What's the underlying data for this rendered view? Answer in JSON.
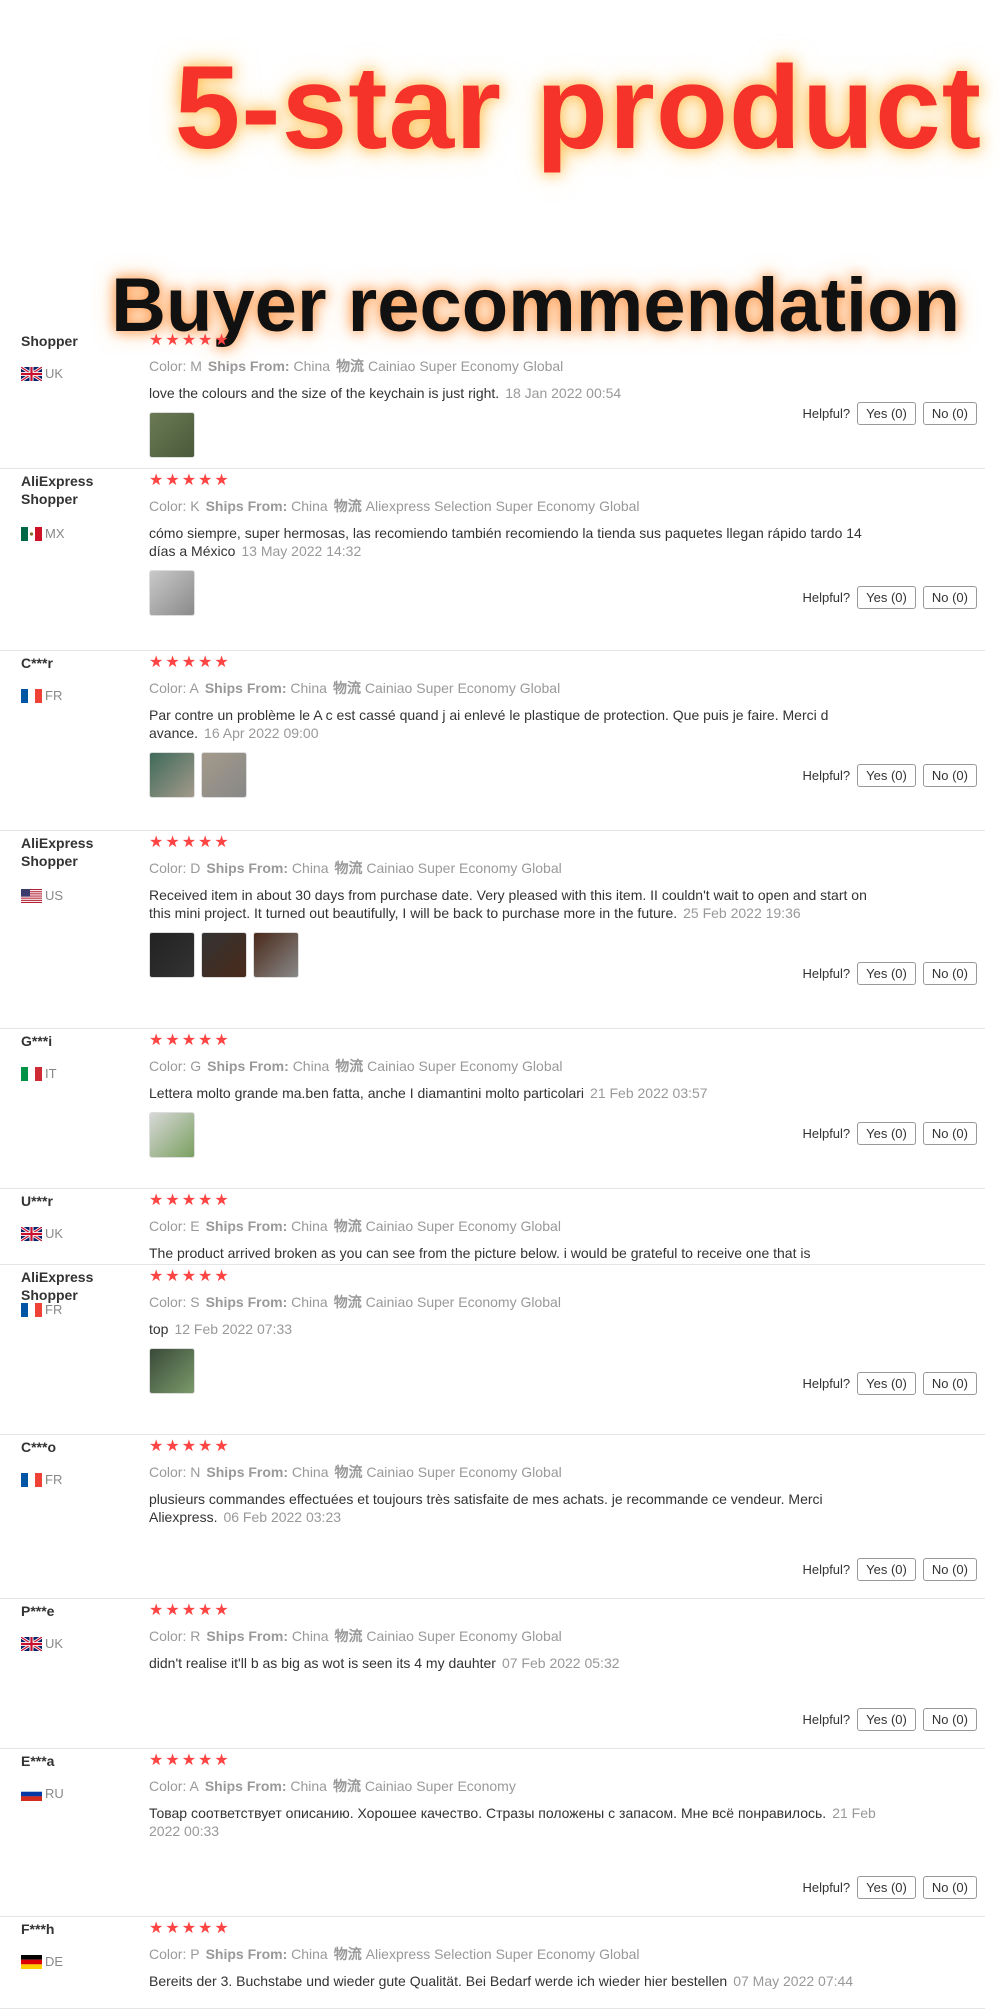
{
  "banner": {
    "title": "5-star product",
    "subtitle": "Buyer recommendation"
  },
  "labels": {
    "helpful": "Helpful?",
    "ships_from": "Ships From:",
    "logistics": "物流"
  },
  "reviews": [
    {
      "user": "Shopper",
      "country": "UK",
      "rating": 5,
      "color": "Color: M",
      "ship_from": "China",
      "logistics": "Cainiao Super Economy Global",
      "text": "love the colours and the size of the keychain is just right.",
      "date": "18 Jan 2022 00:54",
      "yes": "Yes (0)",
      "no": "No (0)"
    },
    {
      "user": "AliExpress Shopper",
      "country": "MX",
      "rating": 5,
      "color": "Color: K",
      "ship_from": "China",
      "logistics": "Aliexpress Selection Super Economy Global",
      "text": "cómo siempre, super hermosas, las recomiendo también recomiendo la tienda sus paquetes llegan rápido tardo 14 días a México",
      "date": "13 May 2022 14:32",
      "yes": "Yes (0)",
      "no": "No (0)"
    },
    {
      "user": "C***r",
      "country": "FR",
      "rating": 4.5,
      "color": "Color: A",
      "ship_from": "China",
      "logistics": "Cainiao Super Economy Global",
      "text": "Par contre un problème le A c est cassé quand j ai enlevé le plastique de protection. Que puis je faire. Merci d avance.",
      "date": "16 Apr 2022 09:00",
      "yes": "Yes (0)",
      "no": "No (0)"
    },
    {
      "user": "AliExpress Shopper",
      "country": "US",
      "rating": 5,
      "color": "Color: D",
      "ship_from": "China",
      "logistics": "Cainiao Super Economy Global",
      "text": "Received item in about 30 days from purchase date. Very pleased with this item. II couldn't wait to open and start on this mini project. It turned out beautifully, I will be back to purchase more in the future.",
      "date": "25 Feb 2022 19:36",
      "yes": "Yes (0)",
      "no": "No (0)"
    },
    {
      "user": "G***i",
      "country": "IT",
      "rating": 4.5,
      "color": "Color: G",
      "ship_from": "China",
      "logistics": "Cainiao Super Economy Global",
      "text": "Lettera molto grande ma.ben fatta, anche I diamantini molto particolari",
      "date": "21 Feb 2022 03:57",
      "yes": "Yes (0)",
      "no": "No (0)"
    },
    {
      "user": "U***r",
      "country": "UK",
      "rating": 5,
      "color": "Color: E",
      "ship_from": "China",
      "logistics": "Cainiao Super Economy Global",
      "text": "The product arrived broken as you can see from the picture below. i would be grateful to receive one that is",
      "date": "",
      "yes": "",
      "no": ""
    },
    {
      "user": "AliExpress Shopper",
      "country": "FR",
      "rating": 5,
      "color": "Color: S",
      "ship_from": "China",
      "logistics": "Cainiao Super Economy Global",
      "text": "top",
      "date": "12 Feb 2022 07:33",
      "yes": "Yes (0)",
      "no": "No (0)"
    },
    {
      "user": "C***o",
      "country": "FR",
      "rating": 5,
      "color": "Color: N",
      "ship_from": "China",
      "logistics": "Cainiao Super Economy Global",
      "text": "plusieurs commandes effectuées et toujours très satisfaite de mes achats. je recommande ce vendeur. Merci Aliexpress.",
      "date": "06 Feb 2022 03:23",
      "yes": "Yes (0)",
      "no": "No (0)"
    },
    {
      "user": "P***e",
      "country": "UK",
      "rating": 5,
      "color": "Color: R",
      "ship_from": "China",
      "logistics": "Cainiao Super Economy Global",
      "text": "didn't realise it'll b as big as wot is seen its 4 my dauhter",
      "date": "07 Feb 2022 05:32",
      "yes": "Yes (0)",
      "no": "No (0)"
    },
    {
      "user": "E***a",
      "country": "RU",
      "rating": 5,
      "color": "Color: A",
      "ship_from": "China",
      "logistics": "Cainiao Super Economy",
      "text": "Товар соответствует описанию. Хорошее качество. Стразы положены с запасом. Мне всё понравилось.",
      "date": "21 Feb 2022 00:33",
      "yes": "Yes (0)",
      "no": "No (0)"
    },
    {
      "user": "F***h",
      "country": "DE",
      "rating": 5,
      "color": "Color: P",
      "ship_from": "China",
      "logistics": "Aliexpress Selection Super Economy Global",
      "text": "Bereits der 3. Buchstabe und wieder gute Qualität. Bei Bedarf werde ich wieder hier bestellen",
      "date": "07 May 2022 07:44",
      "yes": "",
      "no": ""
    }
  ]
}
